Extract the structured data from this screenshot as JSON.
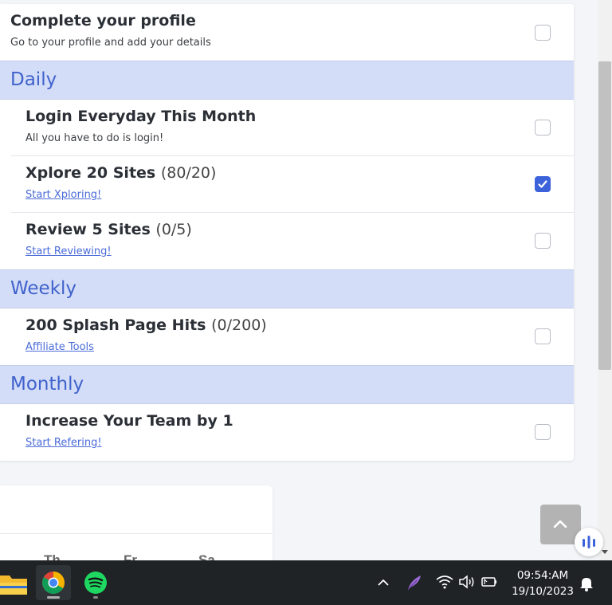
{
  "tasks": {
    "profile": {
      "title": "Complete your profile",
      "subtitle": "Go to your profile and add your details",
      "checked": false
    },
    "sections": [
      {
        "name": "Daily",
        "items": [
          {
            "title": "Login Everyday This Month",
            "count": "",
            "subtitle": "All you have to do is login!",
            "link": false,
            "checked": false
          },
          {
            "title": "Xplore 20 Sites",
            "count": "(80/20)",
            "subtitle": "Start Xploring!",
            "link": true,
            "checked": true
          },
          {
            "title": "Review 5 Sites",
            "count": "(0/5)",
            "subtitle": "Start Reviewing!",
            "link": true,
            "checked": false
          }
        ]
      },
      {
        "name": "Weekly",
        "items": [
          {
            "title": "200 Splash Page Hits",
            "count": "(0/200)",
            "subtitle": "Affiliate Tools",
            "link": true,
            "checked": false
          }
        ]
      },
      {
        "name": "Monthly",
        "items": [
          {
            "title": "Increase Your Team by 1",
            "count": "",
            "subtitle": "Start Refering!",
            "link": true,
            "checked": false
          }
        ]
      }
    ]
  },
  "calendar": {
    "weekdays": [
      "Th",
      "Fr",
      "Sa"
    ]
  },
  "taskbar": {
    "apps": [
      "file-explorer-icon",
      "chrome-icon",
      "spotify-icon"
    ],
    "time": "09:54:AM",
    "date": "19/10/2023"
  },
  "colors": {
    "accent": "#4062cc",
    "section_bg": "#d3ddf7",
    "checkbox_checked": "#3d63db",
    "link": "#4a6bd8"
  }
}
